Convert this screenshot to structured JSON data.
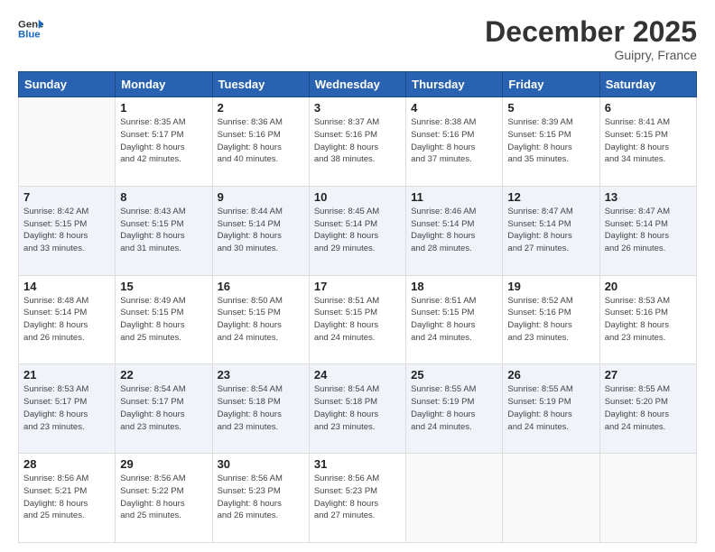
{
  "header": {
    "logo_line1": "General",
    "logo_line2": "Blue",
    "month": "December 2025",
    "location": "Guipry, France"
  },
  "weekdays": [
    "Sunday",
    "Monday",
    "Tuesday",
    "Wednesday",
    "Thursday",
    "Friday",
    "Saturday"
  ],
  "weeks": [
    [
      {
        "day": "",
        "info": ""
      },
      {
        "day": "1",
        "info": "Sunrise: 8:35 AM\nSunset: 5:17 PM\nDaylight: 8 hours\nand 42 minutes."
      },
      {
        "day": "2",
        "info": "Sunrise: 8:36 AM\nSunset: 5:16 PM\nDaylight: 8 hours\nand 40 minutes."
      },
      {
        "day": "3",
        "info": "Sunrise: 8:37 AM\nSunset: 5:16 PM\nDaylight: 8 hours\nand 38 minutes."
      },
      {
        "day": "4",
        "info": "Sunrise: 8:38 AM\nSunset: 5:16 PM\nDaylight: 8 hours\nand 37 minutes."
      },
      {
        "day": "5",
        "info": "Sunrise: 8:39 AM\nSunset: 5:15 PM\nDaylight: 8 hours\nand 35 minutes."
      },
      {
        "day": "6",
        "info": "Sunrise: 8:41 AM\nSunset: 5:15 PM\nDaylight: 8 hours\nand 34 minutes."
      }
    ],
    [
      {
        "day": "7",
        "info": "Sunrise: 8:42 AM\nSunset: 5:15 PM\nDaylight: 8 hours\nand 33 minutes."
      },
      {
        "day": "8",
        "info": "Sunrise: 8:43 AM\nSunset: 5:15 PM\nDaylight: 8 hours\nand 31 minutes."
      },
      {
        "day": "9",
        "info": "Sunrise: 8:44 AM\nSunset: 5:14 PM\nDaylight: 8 hours\nand 30 minutes."
      },
      {
        "day": "10",
        "info": "Sunrise: 8:45 AM\nSunset: 5:14 PM\nDaylight: 8 hours\nand 29 minutes."
      },
      {
        "day": "11",
        "info": "Sunrise: 8:46 AM\nSunset: 5:14 PM\nDaylight: 8 hours\nand 28 minutes."
      },
      {
        "day": "12",
        "info": "Sunrise: 8:47 AM\nSunset: 5:14 PM\nDaylight: 8 hours\nand 27 minutes."
      },
      {
        "day": "13",
        "info": "Sunrise: 8:47 AM\nSunset: 5:14 PM\nDaylight: 8 hours\nand 26 minutes."
      }
    ],
    [
      {
        "day": "14",
        "info": "Sunrise: 8:48 AM\nSunset: 5:14 PM\nDaylight: 8 hours\nand 26 minutes."
      },
      {
        "day": "15",
        "info": "Sunrise: 8:49 AM\nSunset: 5:15 PM\nDaylight: 8 hours\nand 25 minutes."
      },
      {
        "day": "16",
        "info": "Sunrise: 8:50 AM\nSunset: 5:15 PM\nDaylight: 8 hours\nand 24 minutes."
      },
      {
        "day": "17",
        "info": "Sunrise: 8:51 AM\nSunset: 5:15 PM\nDaylight: 8 hours\nand 24 minutes."
      },
      {
        "day": "18",
        "info": "Sunrise: 8:51 AM\nSunset: 5:15 PM\nDaylight: 8 hours\nand 24 minutes."
      },
      {
        "day": "19",
        "info": "Sunrise: 8:52 AM\nSunset: 5:16 PM\nDaylight: 8 hours\nand 23 minutes."
      },
      {
        "day": "20",
        "info": "Sunrise: 8:53 AM\nSunset: 5:16 PM\nDaylight: 8 hours\nand 23 minutes."
      }
    ],
    [
      {
        "day": "21",
        "info": "Sunrise: 8:53 AM\nSunset: 5:17 PM\nDaylight: 8 hours\nand 23 minutes."
      },
      {
        "day": "22",
        "info": "Sunrise: 8:54 AM\nSunset: 5:17 PM\nDaylight: 8 hours\nand 23 minutes."
      },
      {
        "day": "23",
        "info": "Sunrise: 8:54 AM\nSunset: 5:18 PM\nDaylight: 8 hours\nand 23 minutes."
      },
      {
        "day": "24",
        "info": "Sunrise: 8:54 AM\nSunset: 5:18 PM\nDaylight: 8 hours\nand 23 minutes."
      },
      {
        "day": "25",
        "info": "Sunrise: 8:55 AM\nSunset: 5:19 PM\nDaylight: 8 hours\nand 24 minutes."
      },
      {
        "day": "26",
        "info": "Sunrise: 8:55 AM\nSunset: 5:19 PM\nDaylight: 8 hours\nand 24 minutes."
      },
      {
        "day": "27",
        "info": "Sunrise: 8:55 AM\nSunset: 5:20 PM\nDaylight: 8 hours\nand 24 minutes."
      }
    ],
    [
      {
        "day": "28",
        "info": "Sunrise: 8:56 AM\nSunset: 5:21 PM\nDaylight: 8 hours\nand 25 minutes."
      },
      {
        "day": "29",
        "info": "Sunrise: 8:56 AM\nSunset: 5:22 PM\nDaylight: 8 hours\nand 25 minutes."
      },
      {
        "day": "30",
        "info": "Sunrise: 8:56 AM\nSunset: 5:23 PM\nDaylight: 8 hours\nand 26 minutes."
      },
      {
        "day": "31",
        "info": "Sunrise: 8:56 AM\nSunset: 5:23 PM\nDaylight: 8 hours\nand 27 minutes."
      },
      {
        "day": "",
        "info": ""
      },
      {
        "day": "",
        "info": ""
      },
      {
        "day": "",
        "info": ""
      }
    ]
  ]
}
